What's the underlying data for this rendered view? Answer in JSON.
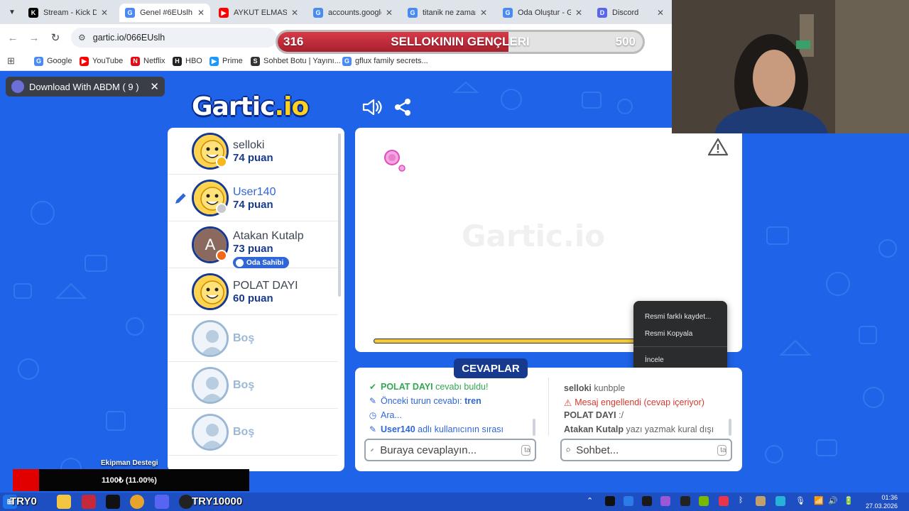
{
  "browser": {
    "tabs": [
      {
        "label": "Stream - Kick Da",
        "favicon_color": "#000000",
        "favicon_glyph": "K",
        "active": false
      },
      {
        "label": "Genel #6EUslh (",
        "favicon_color": "#4a8af4",
        "favicon_glyph": "G",
        "active": true
      },
      {
        "label": "AYKUT ELMAS H",
        "favicon_color": "#ff0000",
        "favicon_glyph": "▶",
        "active": false
      },
      {
        "label": "accounts.google",
        "favicon_color": "#4a8af4",
        "favicon_glyph": "G",
        "active": false
      },
      {
        "label": "titanik ne zaman",
        "favicon_color": "#4a8af4",
        "favicon_glyph": "G",
        "active": false
      },
      {
        "label": "Oda Oluştur - G",
        "favicon_color": "#4a8af4",
        "favicon_glyph": "G",
        "active": false
      },
      {
        "label": "Discord",
        "favicon_color": "#5865f2",
        "favicon_glyph": "D",
        "active": false
      }
    ],
    "url": "gartic.io/066EUslh",
    "bookmarks": [
      {
        "label": "Google",
        "icon": "google-icon",
        "color": "#4a8af4",
        "glyph": "G"
      },
      {
        "label": "YouTube",
        "icon": "youtube-icon",
        "color": "#ff0000",
        "glyph": "▶"
      },
      {
        "label": "Netflix",
        "icon": "netflix-icon",
        "color": "#e50914",
        "glyph": "N"
      },
      {
        "label": "HBO",
        "icon": "hbo-icon",
        "color": "#222222",
        "glyph": "H"
      },
      {
        "label": "Prime",
        "icon": "prime-icon",
        "color": "#1a98ff",
        "glyph": "▶"
      },
      {
        "label": "Sohbet Botu | Yayını...",
        "icon": "bot-icon",
        "color": "#333333",
        "glyph": "S"
      },
      {
        "label": "gflux family secrets...",
        "icon": "google-icon",
        "color": "#4a8af4",
        "glyph": "G"
      }
    ]
  },
  "goal": {
    "left": "316",
    "title": "SELLOKININ GENÇLERI",
    "right": "500",
    "progress": 0.632
  },
  "abdm": {
    "label": "Download With ABDM ( 9 )"
  },
  "logo": {
    "main": "Gartic",
    "suffix": ".io"
  },
  "players": [
    {
      "name": "selloki",
      "points": "74 puan",
      "status_color": "#f7b81a",
      "avatar": "face",
      "drawing": false
    },
    {
      "name": "User140",
      "points": "74 puan",
      "status_color": "#c7c9cc",
      "avatar": "face",
      "drawing": true
    },
    {
      "name": "Atakan Kutalp",
      "points": "73 puan",
      "status_color": "#f06a1a",
      "avatar": "letter",
      "letter": "A",
      "owner_label": "Oda Sahibi",
      "drawing": false
    },
    {
      "name": "POLAT DAYI",
      "points": "60 puan",
      "status_color": null,
      "avatar": "face",
      "drawing": false
    },
    {
      "name": "Boş",
      "points": "",
      "avatar": "empty"
    },
    {
      "name": "Boş",
      "points": "",
      "avatar": "empty"
    },
    {
      "name": "Boş",
      "points": "",
      "avatar": "empty"
    }
  ],
  "canvas": {
    "watermark": "Gartic.io"
  },
  "context_menu": {
    "items": [
      "Resmi farklı kaydet...",
      "Resmi Kopyala",
      "İncele"
    ]
  },
  "answers": {
    "tab_label": "CEVAPLAR",
    "lines": [
      {
        "icon": "check-icon",
        "color": "#2fa84f",
        "bold": "POLAT DAYI",
        "text": " cevabı buldu!"
      },
      {
        "icon": "pencil-icon",
        "color": "#2f66d8",
        "bold": "",
        "text": "Önceki turun cevabı: ",
        "tail": "tren"
      },
      {
        "icon": "clock-icon",
        "color": "#2f66d8",
        "bold": "",
        "text": "Ara..."
      },
      {
        "icon": "pencil-icon",
        "color": "#2f66d8",
        "bold": "User140",
        "text": " adlı kullanıcının sırası"
      }
    ],
    "placeholder": "Buraya cevaplayın...",
    "tab_hint": "tab"
  },
  "chat": {
    "lines": [
      {
        "user": "selloki",
        "text": " kunbple",
        "warn": false
      },
      {
        "user": "",
        "text": "Mesaj engellendi (cevap içeriyor)",
        "warn": true
      },
      {
        "user": "POLAT DAYI",
        "text": " :/",
        "warn": false
      },
      {
        "user": "Atakan Kutalp",
        "text": " yazı yazmak kural dışı",
        "warn": false
      }
    ],
    "placeholder": "Sohbet...",
    "tab_hint": "tab"
  },
  "equipment": {
    "title": "Ekipman Destegi",
    "value": "1100₺ (11.00%)"
  },
  "taskbar": {
    "left_text": "TRY0",
    "mid_text": "TRY10000",
    "time": "01:36",
    "date": "27.03.2026"
  }
}
